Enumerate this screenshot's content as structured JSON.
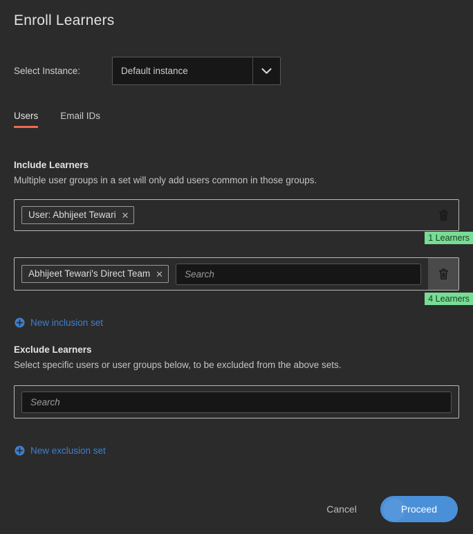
{
  "page_title": "Enroll Learners",
  "instance": {
    "label": "Select Instance:",
    "selected": "Default instance",
    "options": [
      "Default instance"
    ],
    "caret_icon": "chevron-down-icon"
  },
  "tabs": [
    {
      "label": "Users",
      "active": true
    },
    {
      "label": "Email IDs",
      "active": false
    }
  ],
  "include": {
    "title": "Include Learners",
    "subtitle": "Multiple user groups in a set will only add users common in those groups.",
    "sets": [
      {
        "chips": [
          {
            "label": "User: Abhijeet Tewari",
            "remove_icon": "close-icon"
          }
        ],
        "has_search": false,
        "search_placeholder": "",
        "search_value": "",
        "delete_icon": "trash-icon",
        "delete_hovered": false,
        "badge": "1 Learners"
      },
      {
        "chips": [
          {
            "label": "Abhijeet Tewari's Direct Team",
            "remove_icon": "close-icon"
          }
        ],
        "has_search": true,
        "search_placeholder": "Search",
        "search_value": "",
        "delete_icon": "trash-icon",
        "delete_hovered": true,
        "badge": "4 Learners"
      }
    ],
    "add_link": {
      "label": "New inclusion set",
      "icon": "plus-circle-icon"
    }
  },
  "exclude": {
    "title": "Exclude Learners",
    "subtitle": "Select specific users or user groups below, to be excluded from the above sets.",
    "sets": [
      {
        "chips": [],
        "has_search": true,
        "search_placeholder": "Search",
        "search_value": ""
      }
    ],
    "add_link": {
      "label": "New exclusion set",
      "icon": "plus-circle-icon"
    }
  },
  "footer": {
    "cancel_label": "Cancel",
    "proceed_label": "Proceed"
  },
  "colors": {
    "background": "#2b2b2b",
    "accent_tab": "#f26b4d",
    "link": "#3e7fd0",
    "primary_button": "#4a90d9",
    "badge_background": "#77dd94",
    "badge_text": "#1d3a24"
  }
}
